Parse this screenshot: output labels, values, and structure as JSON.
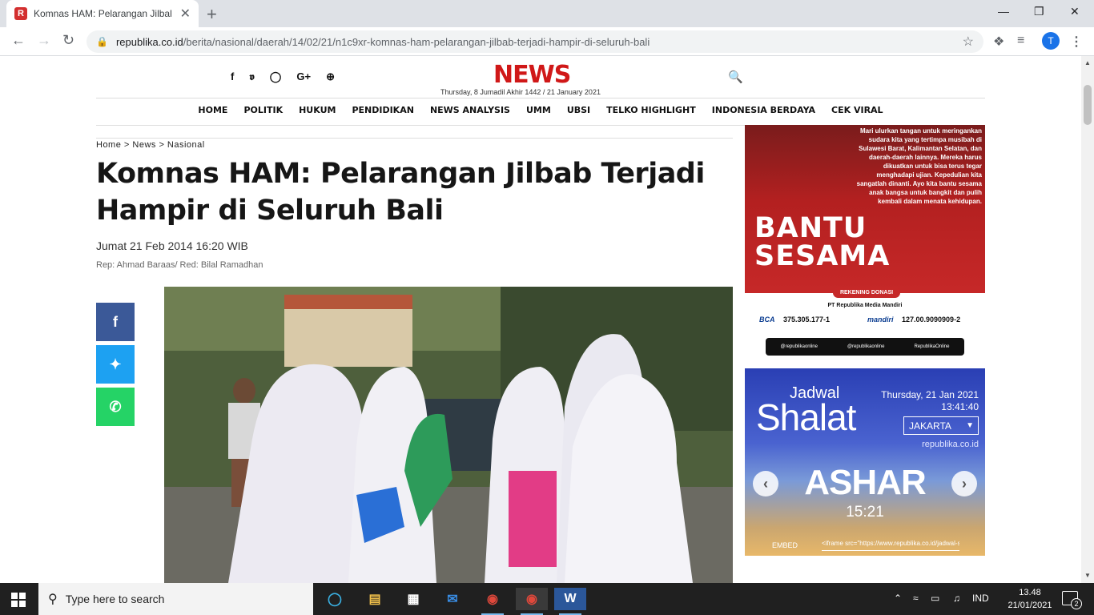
{
  "browser": {
    "tab_title": "Komnas HAM: Pelarangan Jilbab",
    "tab_close": "✕",
    "new_tab": "+",
    "url_domain": "republika.co.id",
    "url_path": "/berita/nasional/daerah/14/02/21/n1c9xr-komnas-ham-pelarangan-jilbab-terjadi-hampir-di-seluruh-bali",
    "profile_initial": "T"
  },
  "site": {
    "logo": "NEWS",
    "date_line": "Thursday, 8 Jumadil Akhir 1442 / 21 January 2021",
    "menu": [
      "HOME",
      "POLITIK",
      "HUKUM",
      "PENDIDIKAN",
      "NEWS ANALYSIS",
      "UMM",
      "UBSI",
      "TELKO HIGHLIGHT",
      "INDONESIA BERDAYA",
      "CEK VIRAL"
    ]
  },
  "article": {
    "breadcrumb": "Home > News > Nasional",
    "headline": "Komnas HAM: Pelarangan Jilbab Terjadi Hampir di Seluruh Bali",
    "published": "Jumat 21 Feb 2014 16:20 WIB",
    "reporter": "Rep: Ahmad Baraas/ Red: Bilal Ramadhan"
  },
  "ad": {
    "message": "Mari ulurkan tangan untuk meringankan sudara kita yang tertimpa musibah di Sulawesi Barat, Kalimantan Selatan, dan daerah-daerah lainnya. Mereka harus dikuatkan untuk bisa terus tegar menghadapi ujian. Kepedulian kita sangatlah dinanti. Ayo kita bantu sesama anak bangsa untuk bangkit dan pulih kembali dalam menata kehidupan.",
    "headline_1": "BANTU",
    "headline_2": "SESAMA",
    "rekening_label": "REKENING DONASI",
    "company": "PT Republika Media Mandiri",
    "bank1": "BCA",
    "account1": "375.305.177-1",
    "bank2": "mandiri",
    "account2": "127.00.9090909-2",
    "social": [
      "@republikaonline",
      "@republikaonline",
      "RepublikaOnline"
    ]
  },
  "prayer": {
    "title_small": "Jadwal",
    "title_big": "Shalat",
    "date": "Thursday, 21 Jan 2021",
    "time": "13:41:40",
    "city": "JAKARTA",
    "source": "republika.co.id",
    "current_prayer": "ASHAR",
    "prayer_time": "15:21",
    "embed_label": "EMBED",
    "embed_code": "<iframe src=\"https://www.republika.co.id/jadwal-s"
  },
  "taskbar": {
    "search_placeholder": "Type here to search",
    "language": "IND",
    "clock_time": "13.48",
    "clock_date": "21/01/2021",
    "notifications": "2"
  }
}
